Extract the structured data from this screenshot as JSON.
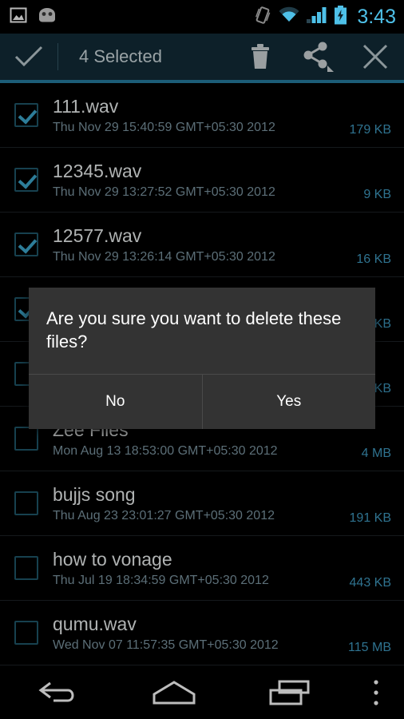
{
  "status_bar": {
    "icons": [
      "screenshot-image-icon",
      "cyanogenmod-android-icon"
    ],
    "right_icons": [
      "vibrate-icon",
      "wifi-icon",
      "signal-icon",
      "battery-charging-icon"
    ],
    "clock": "3:43",
    "clock_color": "#4ec0e8"
  },
  "action_bar": {
    "done_icon": "checkmark-icon",
    "title": "4 Selected",
    "delete_icon": "trash-icon",
    "share_icon": "share-icon",
    "close_icon": "close-icon",
    "background": "#0d2029",
    "accent_color": "#1c5d78"
  },
  "files": [
    {
      "name": "111.wav",
      "date": "Thu Nov 29 15:40:59 GMT+05:30 2012",
      "size": "179 KB",
      "checked": true
    },
    {
      "name": "12345.wav",
      "date": "Thu Nov 29 13:27:52 GMT+05:30 2012",
      "size": "9 KB",
      "checked": true
    },
    {
      "name": "12577.wav",
      "date": "Thu Nov 29 13:26:14 GMT+05:30 2012",
      "size": "16 KB",
      "checked": true
    },
    {
      "name": "",
      "date": "",
      "size": "KB",
      "checked": true
    },
    {
      "name": "",
      "date": "",
      "size": "KB",
      "checked": false
    },
    {
      "name": "Zee Files",
      "date": "Mon Aug 13 18:53:00 GMT+05:30 2012",
      "size": "4 MB",
      "checked": false
    },
    {
      "name": "bujjs song",
      "date": "Thu Aug 23 23:01:27 GMT+05:30 2012",
      "size": "191 KB",
      "checked": false
    },
    {
      "name": "how to vonage",
      "date": "Thu Jul 19 18:34:59 GMT+05:30 2012",
      "size": "443 KB",
      "checked": false
    },
    {
      "name": "qumu.wav",
      "date": "Wed Nov 07 11:57:35 GMT+05:30 2012",
      "size": "115 MB",
      "checked": false
    }
  ],
  "dialog": {
    "message": "Are you sure you want to delete these files?",
    "no_label": "No",
    "yes_label": "Yes",
    "background": "#333333"
  },
  "nav_bar": {
    "back_icon": "back-arrow-icon",
    "home_icon": "home-icon",
    "recents_icon": "recents-icon",
    "overflow_icon": "overflow-menu-icon"
  }
}
